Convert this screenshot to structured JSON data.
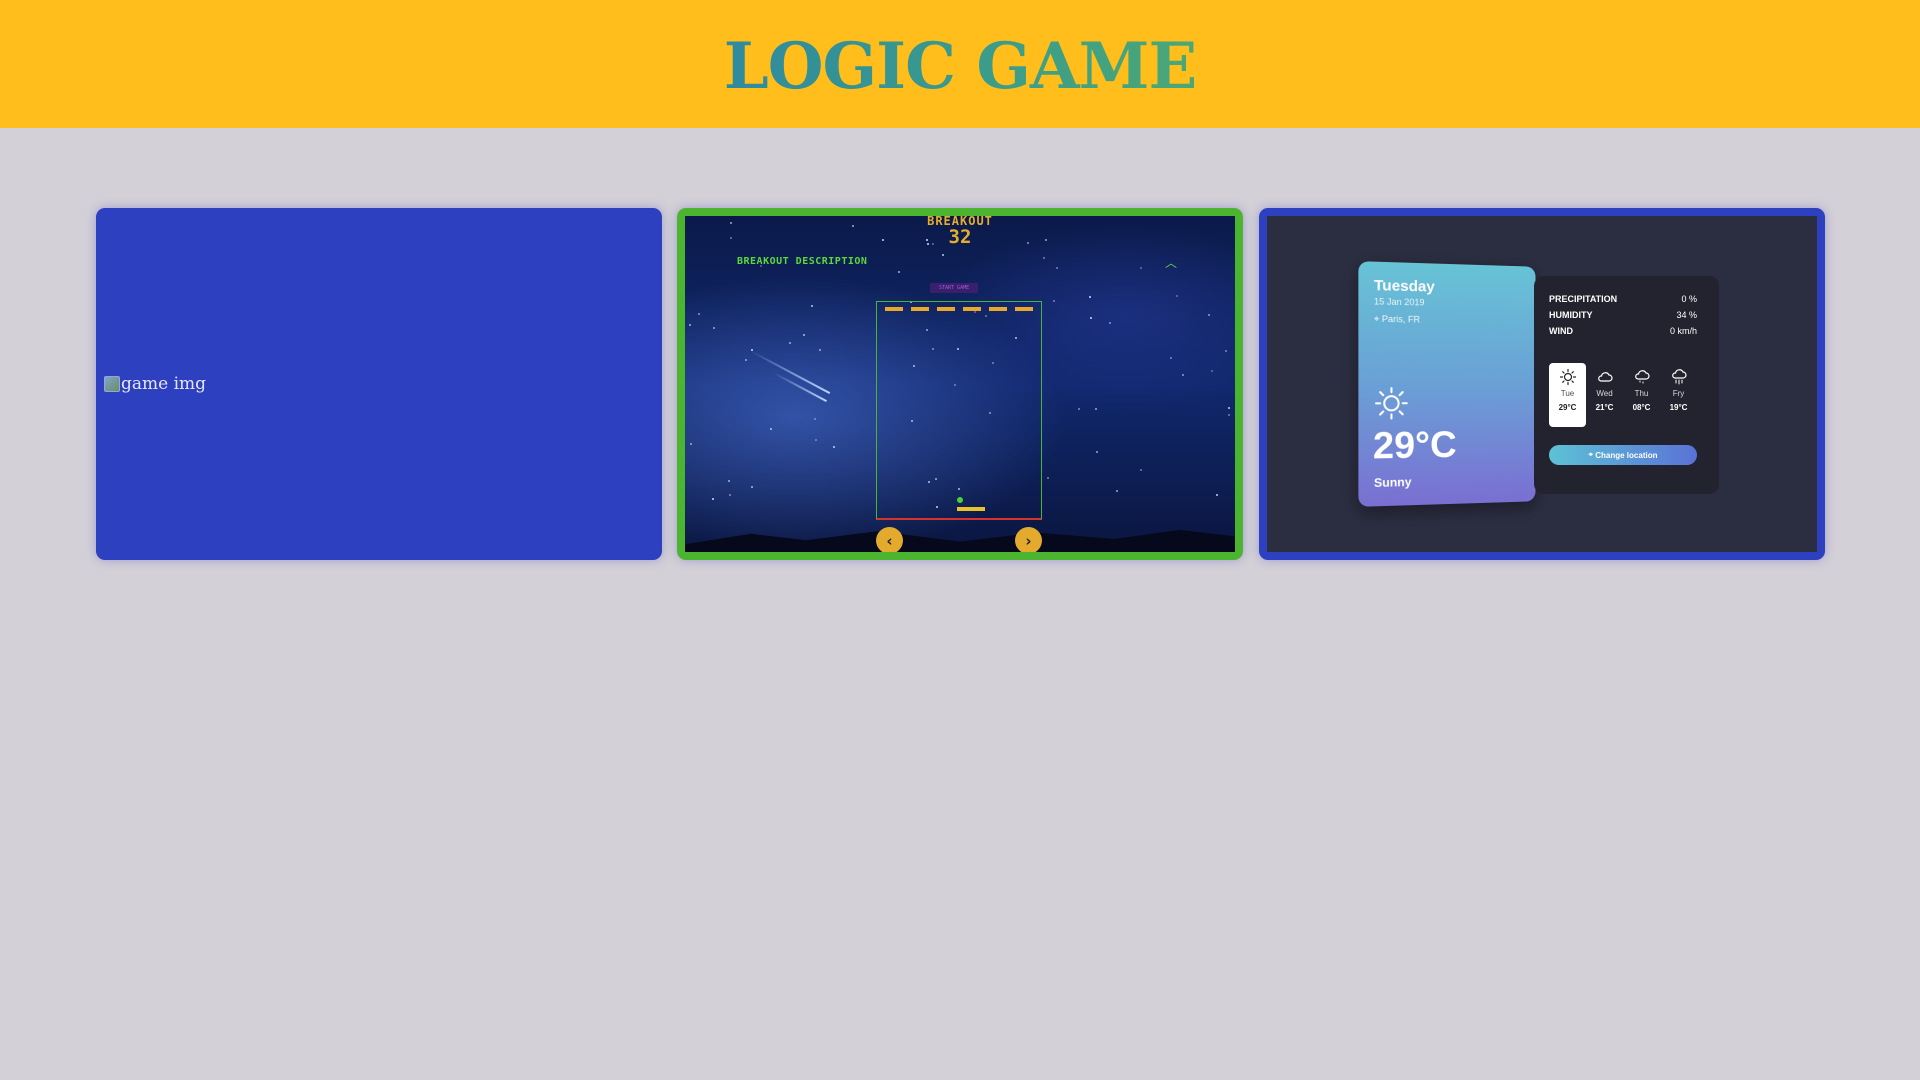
{
  "header": {
    "title": "LOGIC GAME",
    "bg_color": "#ffbe1c"
  },
  "cards": [
    {
      "alt_text": "game img",
      "border_color": "#2d41c0"
    },
    {
      "border_color": "#4cb52f",
      "breakout": {
        "title": "BREAKOUT",
        "score": "32",
        "description": "BREAKOUT DESCRIPTION",
        "start_button": "START GAME",
        "prev_icon": "chevron-left-icon",
        "next_icon": "chevron-right-icon"
      }
    },
    {
      "border_color": "#2d41c0",
      "weather": {
        "day": "Tuesday",
        "date": "15 Jan 2019",
        "location": "Paris, FR",
        "temperature": "29°C",
        "condition": "Sunny",
        "details": [
          {
            "label": "PRECIPITATION",
            "value": "0 %"
          },
          {
            "label": "HUMIDITY",
            "value": "34 %"
          },
          {
            "label": "WIND",
            "value": "0 km/h"
          }
        ],
        "forecast": [
          {
            "day": "Tue",
            "temp": "29°C",
            "icon": "sun-icon",
            "active": true
          },
          {
            "day": "Wed",
            "temp": "21°C",
            "icon": "cloud-icon",
            "active": false
          },
          {
            "day": "Thu",
            "temp": "08°C",
            "icon": "cloud-drizzle-icon",
            "active": false
          },
          {
            "day": "Fry",
            "temp": "19°C",
            "icon": "cloud-rain-icon",
            "active": false
          }
        ],
        "change_location": "Change location"
      }
    }
  ]
}
